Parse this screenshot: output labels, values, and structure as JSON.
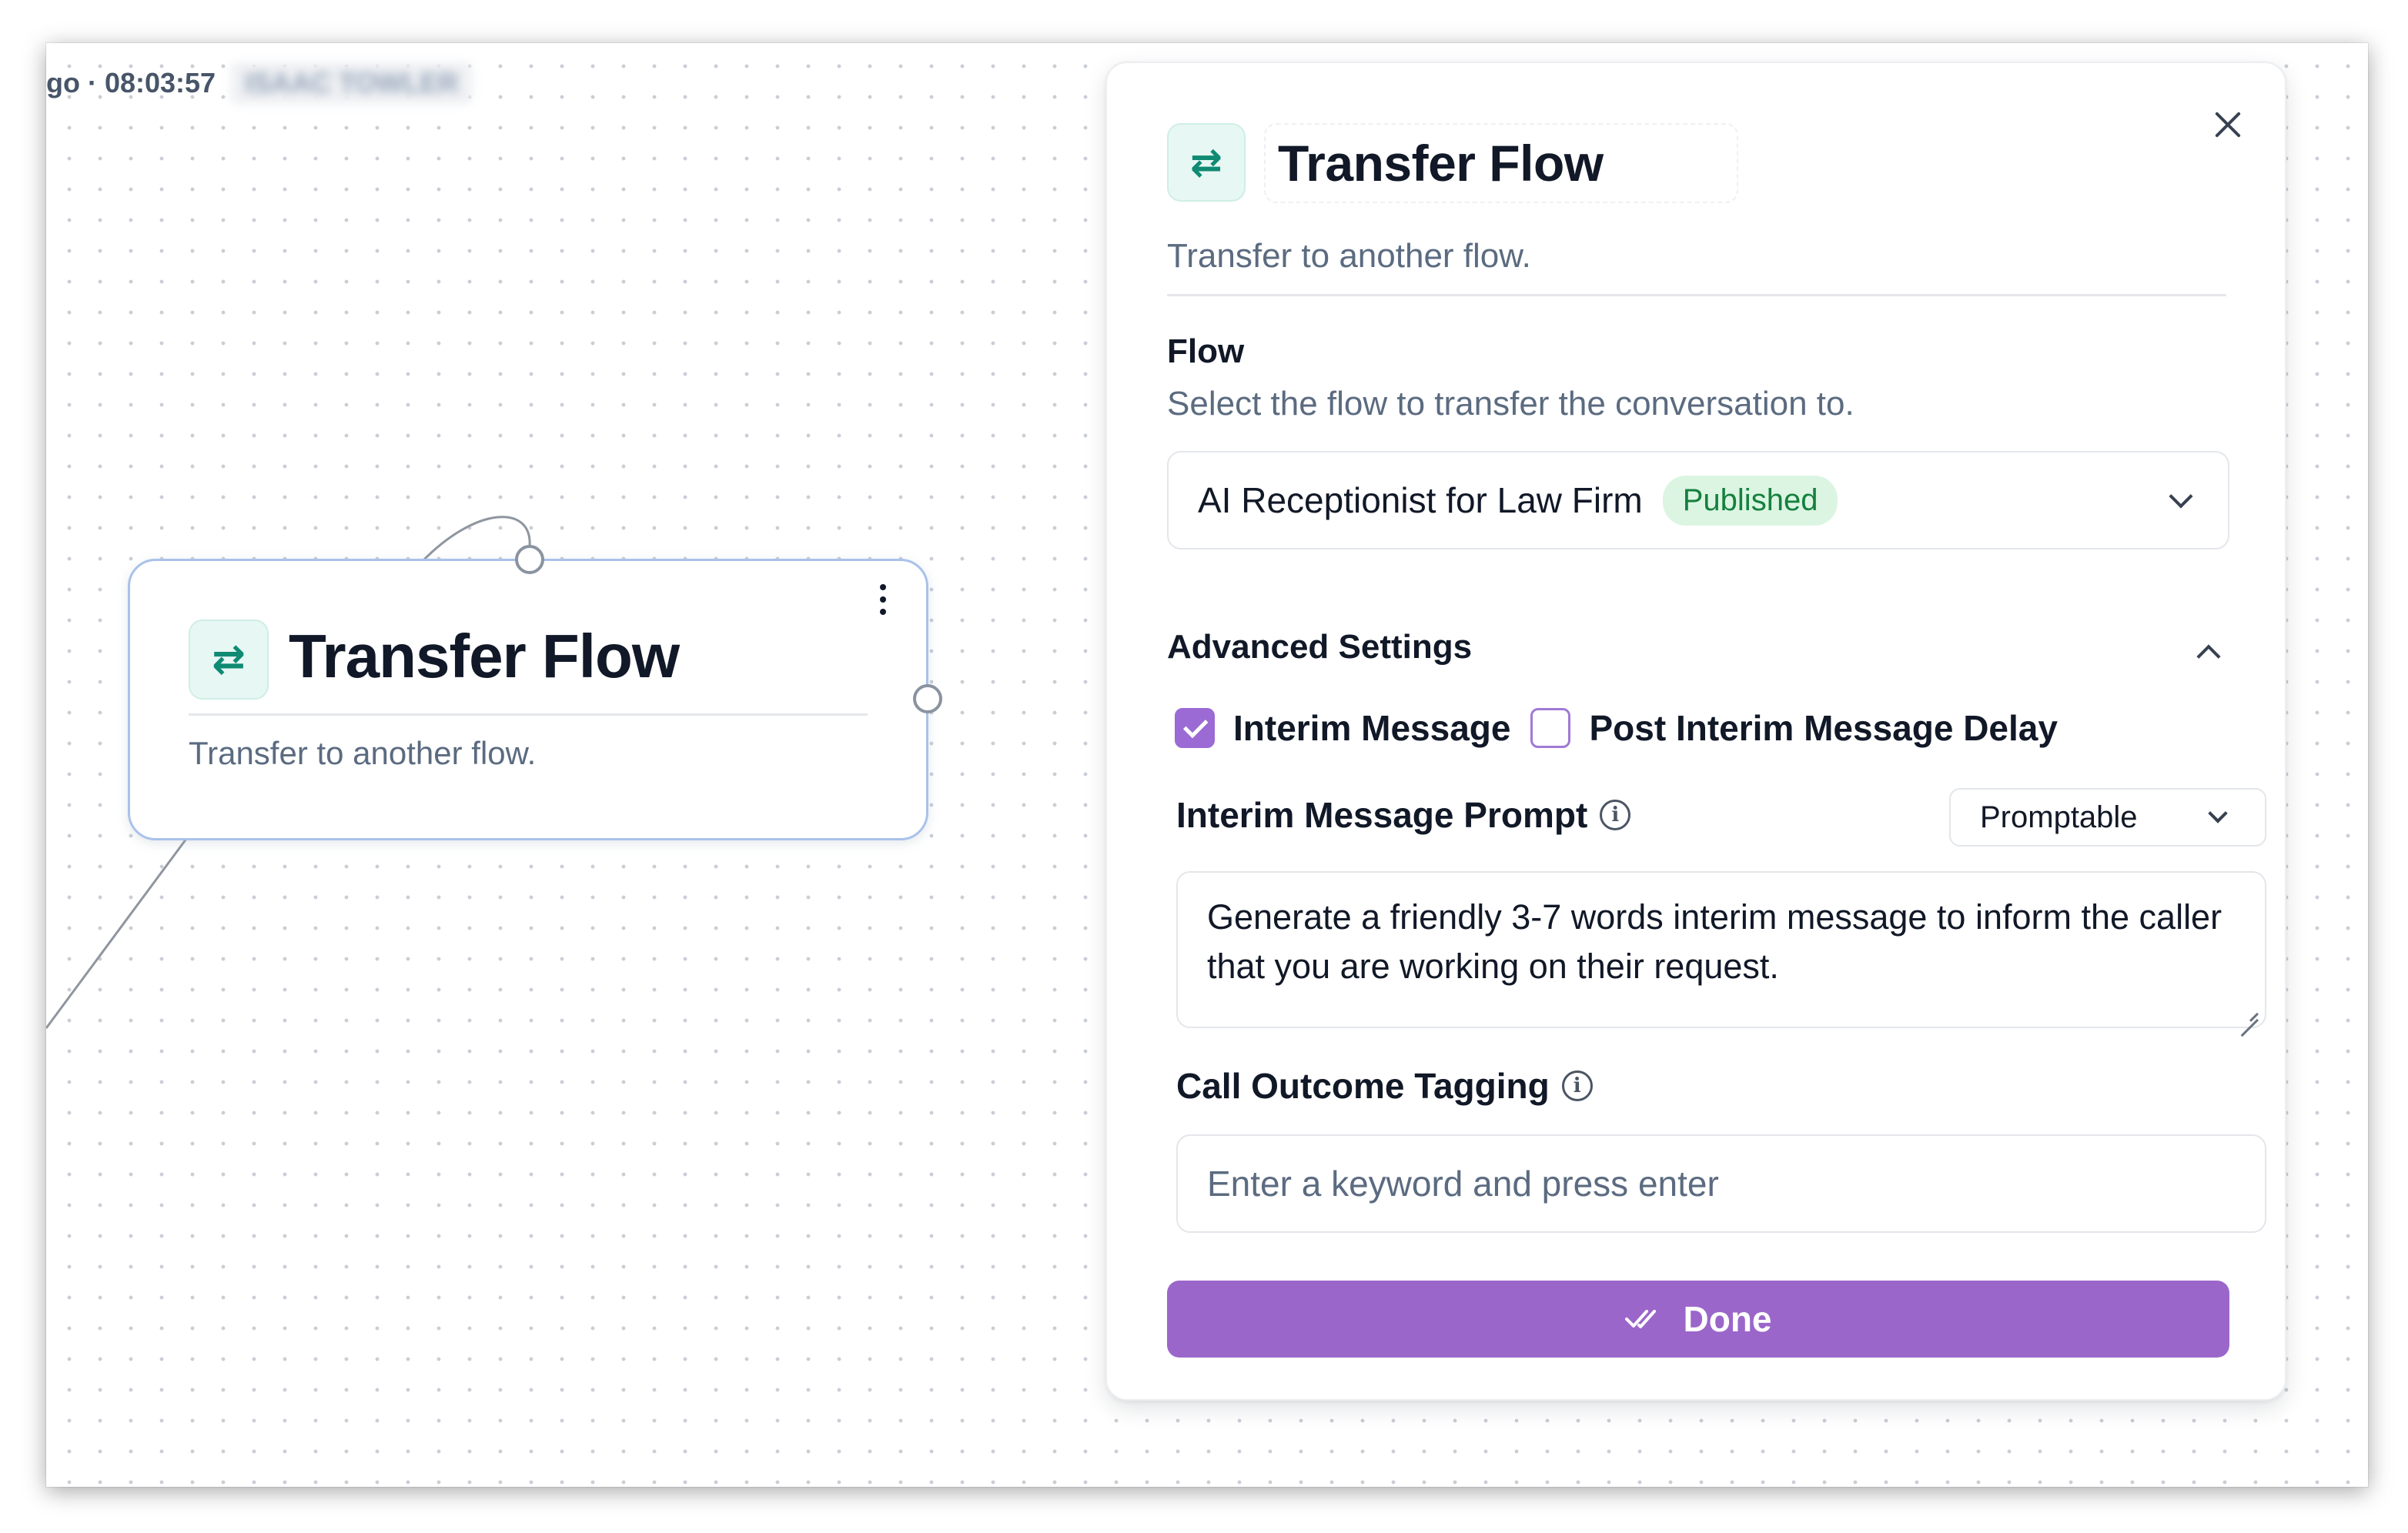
{
  "canvas": {
    "header_text": "go · 08:03:57",
    "header_blurred": "ISAAC TOWLER"
  },
  "node": {
    "icon": "transfer-arrows-icon",
    "title": "Transfer Flow",
    "subtitle": "Transfer to another flow."
  },
  "panel": {
    "icon": "transfer-arrows-icon",
    "title": "Transfer Flow",
    "subtitle": "Transfer to another flow.",
    "flow": {
      "label": "Flow",
      "description": "Select the flow to transfer the conversation to.",
      "selected": "AI Receptionist for Law Firm",
      "badge": "Published"
    },
    "advanced": {
      "label": "Advanced Settings",
      "expanded": true,
      "interim_message": {
        "label": "Interim Message",
        "checked": true
      },
      "post_interim_delay": {
        "label": "Post Interim Message Delay",
        "checked": false
      },
      "interim_prompt": {
        "label": "Interim Message Prompt",
        "mode": "Promptable",
        "value": "Generate a friendly 3-7 words interim message to inform the caller that you are working on their request."
      },
      "call_outcome": {
        "label": "Call Outcome Tagging",
        "placeholder": "Enter a keyword and press enter"
      }
    },
    "done_label": "Done"
  },
  "colors": {
    "accent": "#9b66ca",
    "icon_green": "#0f8a73",
    "badge_bg": "#dcf5e3",
    "badge_text": "#15803d",
    "muted_text": "#5b6b80"
  }
}
